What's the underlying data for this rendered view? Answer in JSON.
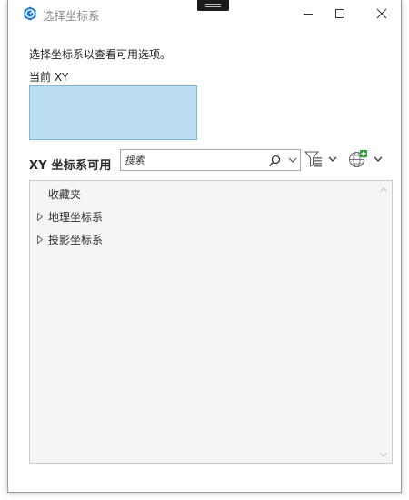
{
  "window": {
    "title": "选择坐标系",
    "app_icon": "arcgis-pro-icon",
    "controls": [
      "minimize-icon",
      "maximize-icon",
      "close-icon"
    ]
  },
  "dialog": {
    "prompt": "选择坐标系以查看可用选项。",
    "current_label": "当前 XY",
    "current_value": "",
    "available_label": "XY 坐标系可用"
  },
  "search": {
    "placeholder": "搜索",
    "icon": "search-icon",
    "dropdown_icon": "chevron-down-icon"
  },
  "toolbar": {
    "filter_icon": "filter-icon",
    "add_coordinate_system_icon": "globe-add-icon"
  },
  "tree": {
    "items": [
      {
        "label": "收藏夹",
        "expandable": false
      },
      {
        "label": "地理坐标系",
        "expandable": true
      },
      {
        "label": "投影坐标系",
        "expandable": true
      }
    ]
  },
  "colors": {
    "accent": "#1e79c8",
    "selection_box_fill": "#bcdef2",
    "selection_box_border": "#7ab6d8",
    "tree_background": "#f4f5f4"
  }
}
